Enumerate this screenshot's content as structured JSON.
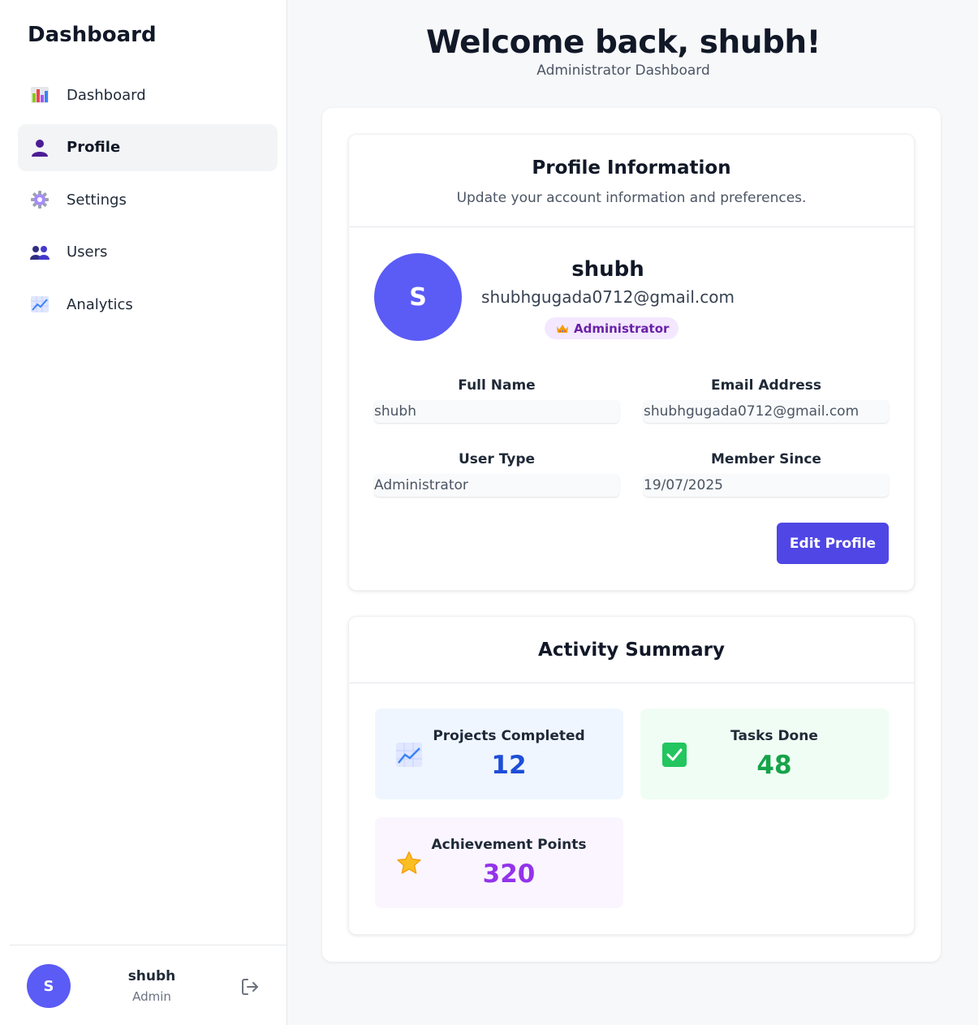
{
  "sidebar": {
    "title": "Dashboard",
    "items": [
      {
        "label": "Dashboard",
        "icon": "bar-chart-icon"
      },
      {
        "label": "Profile",
        "icon": "user-icon"
      },
      {
        "label": "Settings",
        "icon": "gear-icon"
      },
      {
        "label": "Users",
        "icon": "users-icon"
      },
      {
        "label": "Analytics",
        "icon": "line-chart-icon"
      }
    ],
    "active_item": "Profile",
    "footer": {
      "avatar_initial": "S",
      "name": "shubh",
      "role": "Admin"
    }
  },
  "header": {
    "welcome": "Welcome back, shubh!",
    "subtitle": "Administrator Dashboard"
  },
  "profile": {
    "title": "Profile Information",
    "subtitle": "Update your account information and preferences.",
    "avatar_initial": "S",
    "name": "shubh",
    "email": "shubhgugada0712@gmail.com",
    "badge": "Administrator",
    "fields": {
      "full_name_label": "Full Name",
      "full_name_value": "shubh",
      "email_label": "Email Address",
      "email_value": "shubhgugada0712@gmail.com",
      "user_type_label": "User Type",
      "user_type_value": "Administrator",
      "member_since_label": "Member Since",
      "member_since_value": "19/07/2025"
    },
    "edit_button": "Edit Profile"
  },
  "activity": {
    "title": "Activity Summary",
    "stats": [
      {
        "label": "Projects Completed",
        "value": "12",
        "color": "#1d4ed8",
        "bg": "#eff6ff",
        "icon": "chart-up-icon"
      },
      {
        "label": "Tasks Done",
        "value": "48",
        "color": "#16a34a",
        "bg": "#f0fdf4",
        "icon": "checkmark-icon"
      },
      {
        "label": "Achievement Points",
        "value": "320",
        "color": "#9333ea",
        "bg": "#faf5ff",
        "icon": "star-icon"
      }
    ]
  },
  "colors": {
    "accent": "#4f46e5",
    "avatar": "#5b5bf6",
    "badge_bg": "#f3e8ff",
    "badge_text": "#6b21a8"
  }
}
